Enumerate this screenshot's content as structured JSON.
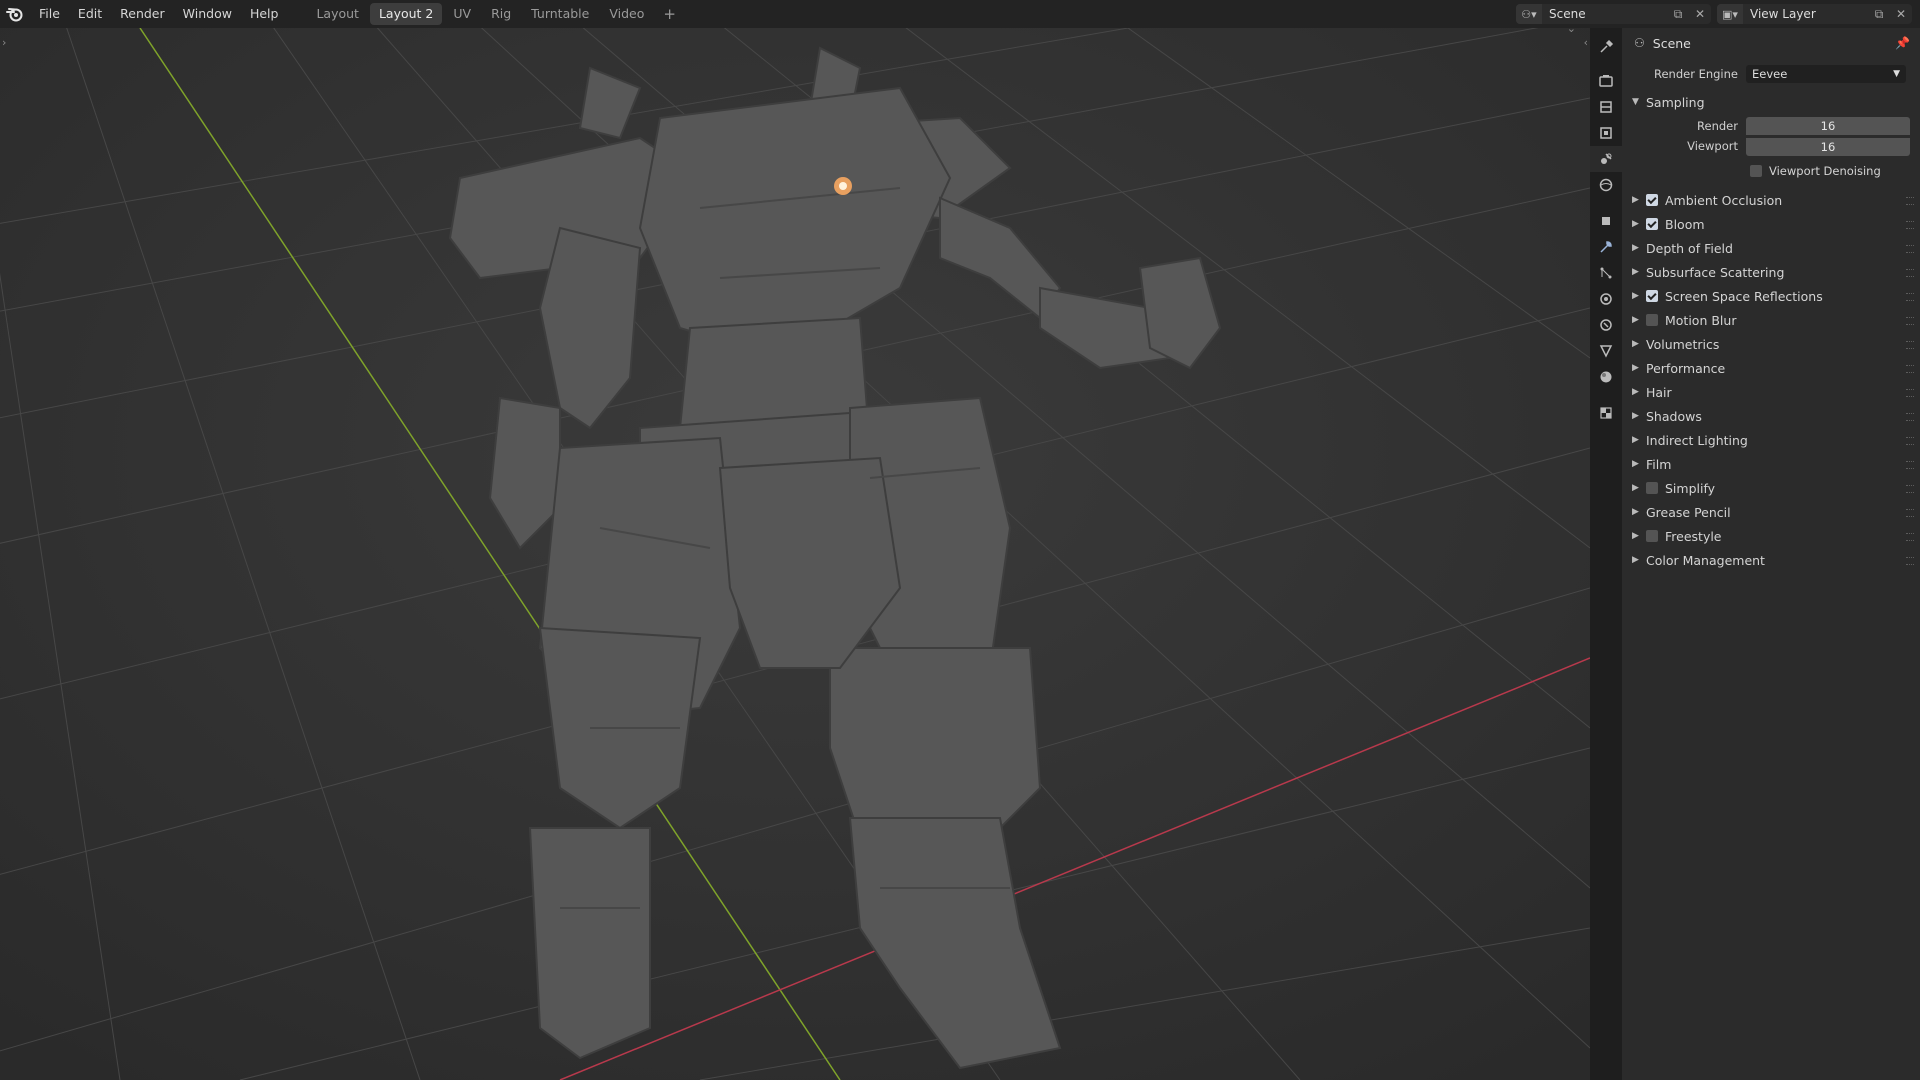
{
  "menu": [
    "File",
    "Edit",
    "Render",
    "Window",
    "Help"
  ],
  "workspaces": [
    {
      "label": "Layout",
      "active": false
    },
    {
      "label": "Layout 2",
      "active": true
    },
    {
      "label": "UV",
      "active": false
    },
    {
      "label": "Rig",
      "active": false
    },
    {
      "label": "Turntable",
      "active": false
    },
    {
      "label": "Video",
      "active": false
    }
  ],
  "workspace_add": "+",
  "scene_selector": {
    "value": "Scene"
  },
  "view_layer_selector": {
    "value": "View Layer"
  },
  "properties": {
    "header_title": "Scene",
    "render_engine_label": "Render Engine",
    "render_engine_value": "Eevee",
    "sampling": {
      "title": "Sampling",
      "render_label": "Render",
      "render_value": "16",
      "viewport_label": "Viewport",
      "viewport_value": "16",
      "denoise_label": "Viewport Denoising"
    },
    "panels": [
      {
        "label": "Ambient Occlusion",
        "checkbox": true,
        "checked": true
      },
      {
        "label": "Bloom",
        "checkbox": true,
        "checked": true
      },
      {
        "label": "Depth of Field",
        "checkbox": false,
        "checked": false
      },
      {
        "label": "Subsurface Scattering",
        "checkbox": false,
        "checked": false
      },
      {
        "label": "Screen Space Reflections",
        "checkbox": true,
        "checked": true
      },
      {
        "label": "Motion Blur",
        "checkbox": true,
        "checked": false
      },
      {
        "label": "Volumetrics",
        "checkbox": false,
        "checked": false
      },
      {
        "label": "Performance",
        "checkbox": false,
        "checked": false
      },
      {
        "label": "Hair",
        "checkbox": false,
        "checked": false
      },
      {
        "label": "Shadows",
        "checkbox": false,
        "checked": false
      },
      {
        "label": "Indirect Lighting",
        "checkbox": false,
        "checked": false
      },
      {
        "label": "Film",
        "checkbox": false,
        "checked": false
      },
      {
        "label": "Simplify",
        "checkbox": true,
        "checked": false
      },
      {
        "label": "Grease Pencil",
        "checkbox": false,
        "checked": false
      },
      {
        "label": "Freestyle",
        "checkbox": true,
        "checked": false
      },
      {
        "label": "Color Management",
        "checkbox": false,
        "checked": false
      }
    ]
  },
  "colors": {
    "x_axis": "#b8394c",
    "y_axis": "#7fa32a",
    "accent": "#e8a060",
    "panel_bg": "#2b2b2b",
    "topbar_bg": "#232323"
  }
}
